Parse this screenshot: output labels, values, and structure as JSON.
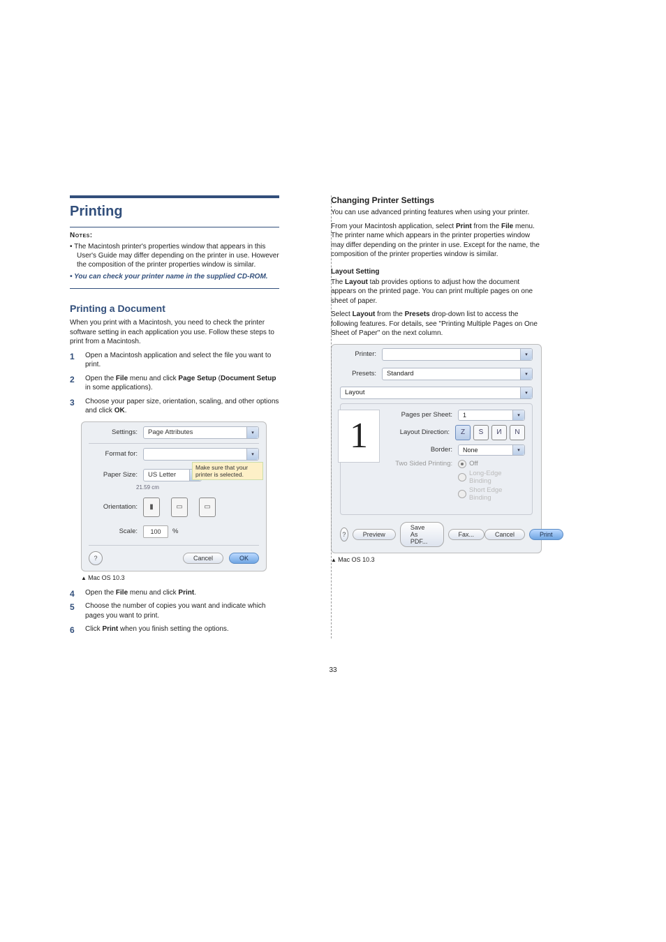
{
  "left": {
    "heading": "Printing",
    "notes_label": "Notes",
    "notes": [
      "The Macintosh printer's properties window that appears in this User's Guide may differ depending on the printer in use. However the composition of the printer properties window is similar.",
      "You can check your printer name in the supplied CD-ROM."
    ],
    "sub_heading": "Printing a Document",
    "intro": "When you print with a Macintosh, you need to check the printer software setting in each application you use. Follow these steps to print from a Macintosh.",
    "steps_a": [
      "Open a Macintosh application and select the file you want to print.",
      "Open the <strong>File</strong> menu and click <strong>Page Setup</strong> (<strong>Document Setup</strong> in some applications).",
      "Choose your paper size, orientation, scaling, and other options and click <strong>OK</strong>."
    ],
    "dialog": {
      "settings_label": "Settings:",
      "settings_value": "Page Attributes",
      "format_label": "Format for:",
      "paper_label": "Paper Size:",
      "paper_value": "US Letter",
      "paper_sub": "21.59 cm",
      "callout": "Make sure that your printer is selected.",
      "orient_label": "Orientation:",
      "scale_label": "Scale:",
      "scale_value": "100",
      "scale_unit": "%",
      "cancel": "Cancel",
      "ok": "OK"
    },
    "caption": "Mac OS 10.3",
    "steps_b": [
      "Open the <strong>File</strong> menu and click <strong>Print</strong>.",
      "Choose the number of copies you want and indicate which pages you want to print.",
      "Click <strong>Print</strong> when you finish setting the options."
    ]
  },
  "right": {
    "heading": "Changing Printer Settings",
    "p1": "You can use advanced printing features when using your printer.",
    "p2": "From your Macintosh application, select <strong>Print</strong> from the <strong>File</strong> menu. The printer name which appears in the printer properties window may differ depending on the printer in use. Except for the name, the composition of the printer properties window is similar.",
    "layout_heading": "Layout Setting",
    "p3": "The <strong>Layout</strong> tab provides options to adjust how the document appears on the printed page. You can print multiple pages on one sheet of paper.",
    "p4": "Select <strong>Layout</strong> from the <strong>Presets</strong> drop-down list to access the following features. For details, see \"Printing Multiple Pages on One Sheet of Paper\" on the next column.",
    "dialog": {
      "printer_label": "Printer:",
      "presets_label": "Presets:",
      "presets_value": "Standard",
      "pane_value": "Layout",
      "pps_label": "Pages per Sheet:",
      "pps_value": "1",
      "ld_label": "Layout Direction:",
      "border_label": "Border:",
      "border_value": "None",
      "tsp_label": "Two Sided Printing:",
      "tsp_opts": [
        "Off",
        "Long-Edge Binding",
        "Short Edge Binding"
      ],
      "preview": "Preview",
      "save_pdf": "Save As PDF...",
      "fax": "Fax...",
      "cancel": "Cancel",
      "print": "Print"
    },
    "caption": "Mac OS 10.3"
  },
  "page_num": "33"
}
